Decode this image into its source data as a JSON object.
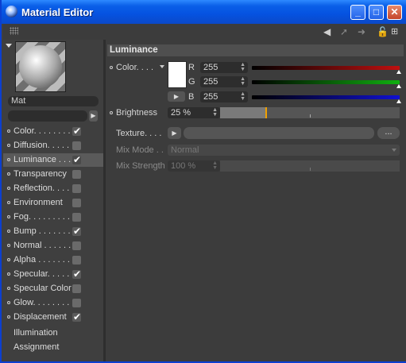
{
  "window": {
    "title": "Material Editor",
    "minimize": "_",
    "maximize": "□",
    "close": "✕"
  },
  "toolbar": {
    "icons": [
      "grip-icon",
      "arrow-left-icon",
      "arrow-up-right-icon",
      "arrow-right-icon",
      "lock-icon",
      "new-window-icon"
    ]
  },
  "material": {
    "name": "Mat"
  },
  "channels": [
    {
      "label": "Color. . . . . . . .",
      "checked": true
    },
    {
      "label": "Diffusion. . . . . .",
      "checked": false
    },
    {
      "label": "Luminance . . . .",
      "checked": true,
      "selected": true
    },
    {
      "label": "Transparency",
      "checked": false
    },
    {
      "label": "Reflection. . . . .",
      "checked": false
    },
    {
      "label": "Environment",
      "checked": false
    },
    {
      "label": "Fog. . . . . . . . .",
      "checked": false
    },
    {
      "label": "Bump . . . . . . .",
      "checked": true
    },
    {
      "label": "Normal . . . . . .",
      "checked": false
    },
    {
      "label": "Alpha . . . . . . .",
      "checked": false
    },
    {
      "label": "Specular. . . . .",
      "checked": true
    },
    {
      "label": "Specular Color",
      "checked": false
    },
    {
      "label": "Glow. . . . . . . .",
      "checked": false
    },
    {
      "label": "Displacement",
      "checked": true
    }
  ],
  "extra_items": [
    "Illumination",
    "Assignment"
  ],
  "panel": {
    "title": "Luminance",
    "color_label": "Color. . . .",
    "color_hex": "#ffffff",
    "r_label": "R",
    "g_label": "G",
    "b_label": "B",
    "r": "255",
    "g": "255",
    "b": "255",
    "r_level": 1.0,
    "g_level": 1.0,
    "b_level": 1.0,
    "brightness_label": "Brightness",
    "brightness": "25 %",
    "brightness_level": 0.25,
    "texture_label": "Texture. . . .",
    "texture_more": "...",
    "mix_mode_label": "Mix Mode . .",
    "mix_mode": "Normal",
    "mix_strength_label": "Mix Strength",
    "mix_strength": "100 %"
  },
  "colors": {
    "red": "#c01010",
    "green": "#10b010",
    "blue": "#1010d0",
    "accent": "#f0a000"
  }
}
